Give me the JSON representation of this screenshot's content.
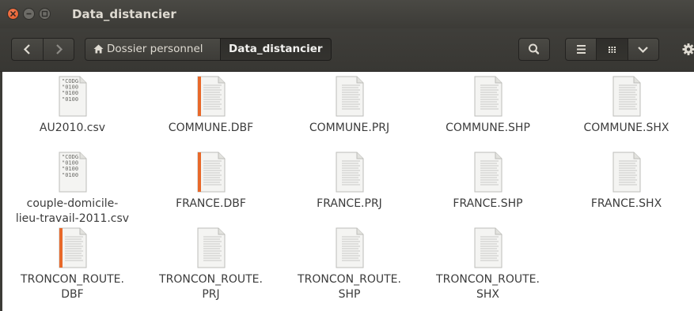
{
  "window": {
    "title": "Data_distancier",
    "controls": [
      "close-icon",
      "minimize-icon",
      "maximize-icon"
    ]
  },
  "toolbar": {
    "back_icon": "chevron-left-icon",
    "forward_icon": "chevron-right-icon",
    "breadcrumb_home_icon": "home-icon",
    "breadcrumb_home": "Dossier personnel",
    "breadcrumb_current": "Data_distancier",
    "search_icon": "search-icon",
    "view_list_icon": "list-view-icon",
    "view_grid_icon": "grid-view-icon",
    "view_more_icon": "chevron-down-icon",
    "settings_icon": "gear-icon"
  },
  "files": [
    {
      "name": "AU2010.csv",
      "type": "csv",
      "preview": [
        "\"CODG",
        "\"0100",
        "\"0100",
        "\"0100"
      ]
    },
    {
      "name": "COMMUNE.DBF",
      "type": "dbf"
    },
    {
      "name": "COMMUNE.PRJ",
      "type": "text"
    },
    {
      "name": "COMMUNE.SHP",
      "type": "text"
    },
    {
      "name": "COMMUNE.SHX",
      "type": "text"
    },
    {
      "name": "couple-domicile-lieu-travail-2011.csv",
      "name_lines": [
        "couple-domicile-",
        "lieu-travail-2011.csv"
      ],
      "type": "csv",
      "preview": [
        "\"CODG",
        "\"0100",
        "\"0100",
        "\"0100"
      ]
    },
    {
      "name": "FRANCE.DBF",
      "type": "dbf"
    },
    {
      "name": "FRANCE.PRJ",
      "type": "text"
    },
    {
      "name": "FRANCE.SHP",
      "type": "text"
    },
    {
      "name": "FRANCE.SHX",
      "type": "text"
    },
    {
      "name": "TRONCON_ROUTE.DBF",
      "name_lines": [
        "TRONCON_ROUTE.",
        "DBF"
      ],
      "type": "dbf"
    },
    {
      "name": "TRONCON_ROUTE.PRJ",
      "name_lines": [
        "TRONCON_ROUTE.",
        "PRJ"
      ],
      "type": "text"
    },
    {
      "name": "TRONCON_ROUTE.SHP",
      "name_lines": [
        "TRONCON_ROUTE.",
        "SHP"
      ],
      "type": "text"
    },
    {
      "name": "TRONCON_ROUTE.SHX",
      "name_lines": [
        "TRONCON_ROUTE.",
        "SHX"
      ],
      "type": "text"
    }
  ],
  "colors": {
    "titlebar": "#3c3b37",
    "close_button": "#e0531f",
    "dbf_stripe": "#e8692a",
    "label_text": "#3c3c3c"
  }
}
